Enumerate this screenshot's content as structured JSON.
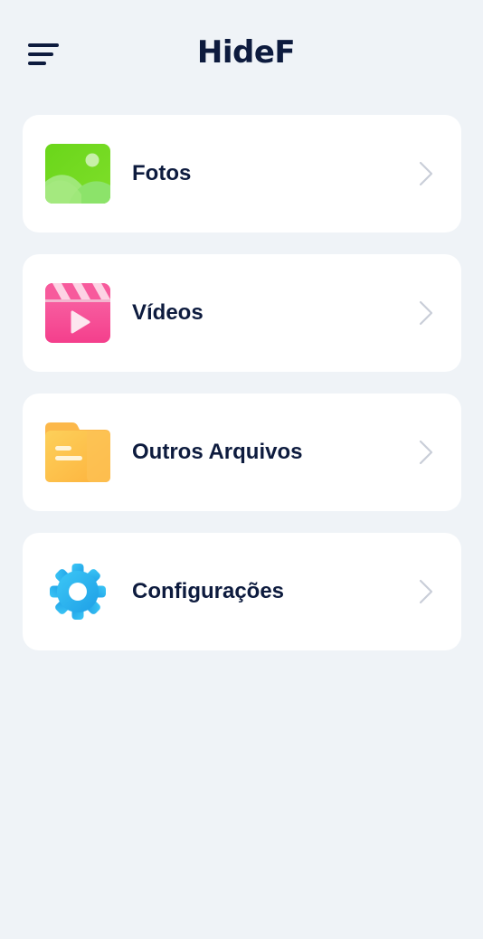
{
  "app": {
    "title": "HideF"
  },
  "menu": {
    "items": [
      {
        "label": "Fotos",
        "icon": "photos-icon",
        "color": "#6bd51c"
      },
      {
        "label": "Vídeos",
        "icon": "videos-icon",
        "color": "#f44a93"
      },
      {
        "label": "Outros Arquivos",
        "icon": "folder-icon",
        "color": "#fbb93d"
      },
      {
        "label": "Configurações",
        "icon": "gear-icon",
        "color": "#27aef0"
      }
    ]
  },
  "colors": {
    "background": "#eff3f7",
    "card": "#ffffff",
    "text": "#0d1b3e",
    "chevron": "#c9ced8"
  }
}
